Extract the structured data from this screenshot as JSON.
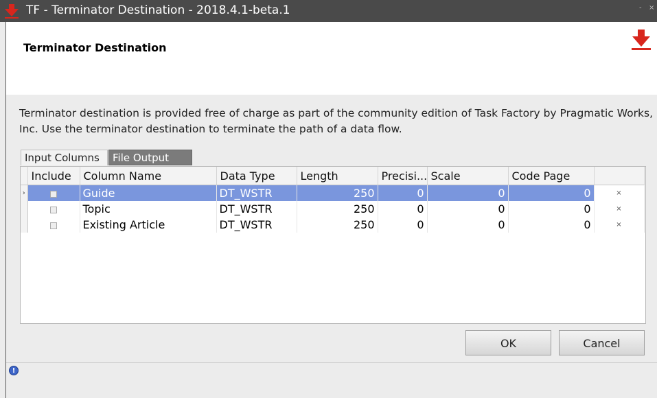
{
  "window": {
    "title": "TF - Terminator Destination - 2018.4.1-beta.1",
    "minimize": "-",
    "close": "×"
  },
  "header": {
    "heading": "Terminator Destination",
    "logo_icon": "task-factory-red-arrow-icon"
  },
  "description": {
    "line1": "Terminator destination is provided free of charge as part of the community edition of Task Factory by Pragmatic Works,",
    "line2": "Inc. Use the terminator destination to terminate the path of a data flow."
  },
  "tabs": [
    {
      "label": "Input Columns",
      "active": false
    },
    {
      "label": "File Output",
      "active": true
    }
  ],
  "grid": {
    "columns": [
      "Include",
      "Column Name",
      "Data Type",
      "Length",
      "Precisi...",
      "Scale",
      "Code Page",
      ""
    ],
    "current_row_marker": "›",
    "delete_glyph": "×",
    "rows": [
      {
        "include": false,
        "name": "Guide",
        "type": "DT_WSTR",
        "length": "250",
        "precision": "0",
        "scale": "0",
        "code_page": "0",
        "selected": true
      },
      {
        "include": false,
        "name": "Topic",
        "type": "DT_WSTR",
        "length": "250",
        "precision": "0",
        "scale": "0",
        "code_page": "0",
        "selected": false
      },
      {
        "include": false,
        "name": "Existing Article",
        "type": "DT_WSTR",
        "length": "250",
        "precision": "0",
        "scale": "0",
        "code_page": "0",
        "selected": false
      }
    ]
  },
  "buttons": {
    "ok": "OK",
    "cancel": "Cancel"
  },
  "status": {
    "help_icon": "help-info-icon"
  },
  "colors": {
    "titlebar": "#4a4a4a",
    "selection": "#7a96dd",
    "accent_red": "#d8261d"
  }
}
